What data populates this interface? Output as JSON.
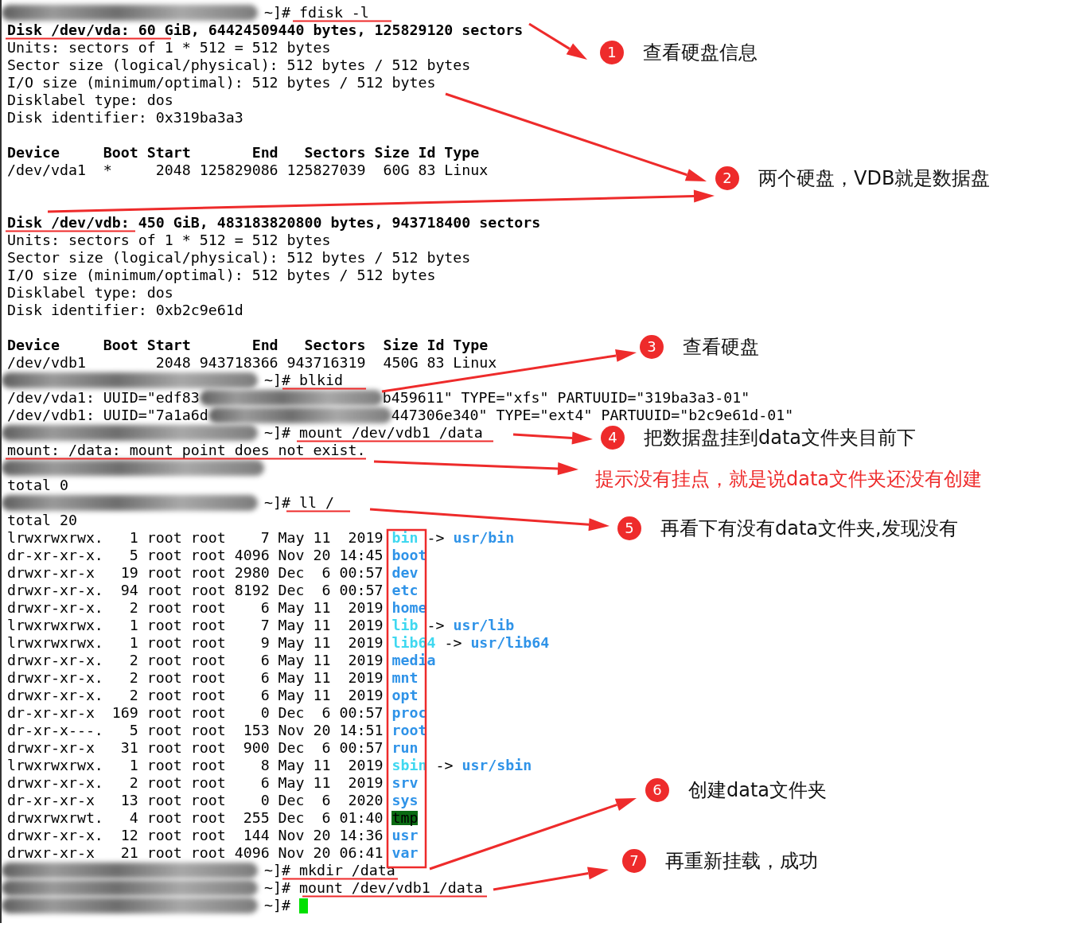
{
  "terminal": {
    "lines": [
      {
        "kind": "prompt",
        "text": "~]# fdisk -l"
      },
      {
        "kind": "heading",
        "text": "Disk /dev/vda: 60 GiB, 64424509440 bytes, 125829120 sectors"
      },
      {
        "kind": "plain",
        "text": "Units: sectors of 1 * 512 = 512 bytes"
      },
      {
        "kind": "plain",
        "text": "Sector size (logical/physical): 512 bytes / 512 bytes"
      },
      {
        "kind": "plain",
        "text": "I/O size (minimum/optimal): 512 bytes / 512 bytes"
      },
      {
        "kind": "plain",
        "text": "Disklabel type: dos"
      },
      {
        "kind": "plain",
        "text": "Disk identifier: 0x319ba3a3"
      },
      {
        "kind": "blank"
      },
      {
        "kind": "heading",
        "text": "Device     Boot Start       End   Sectors Size Id Type"
      },
      {
        "kind": "plain",
        "text": "/dev/vda1  *     2048 125829086 125827039  60G 83 Linux"
      },
      {
        "kind": "blank"
      },
      {
        "kind": "blank"
      },
      {
        "kind": "heading",
        "text": "Disk /dev/vdb: 450 GiB, 483183820800 bytes, 943718400 sectors"
      },
      {
        "kind": "plain",
        "text": "Units: sectors of 1 * 512 = 512 bytes"
      },
      {
        "kind": "plain",
        "text": "Sector size (logical/physical): 512 bytes / 512 bytes"
      },
      {
        "kind": "plain",
        "text": "I/O size (minimum/optimal): 512 bytes / 512 bytes"
      },
      {
        "kind": "plain",
        "text": "Disklabel type: dos"
      },
      {
        "kind": "plain",
        "text": "Disk identifier: 0xb2c9e61d"
      },
      {
        "kind": "blank"
      },
      {
        "kind": "heading",
        "text": "Device     Boot Start       End   Sectors  Size Id Type"
      },
      {
        "kind": "plain",
        "text": "/dev/vdb1        2048 943718366 943716319  450G 83 Linux"
      },
      {
        "kind": "prompt",
        "text": "~]# blkid"
      },
      {
        "kind": "split",
        "before": "/dev/vda1: UUID=\"edf83",
        "after": "b459611\" TYPE=\"xfs\" PARTUUID=\"319ba3a3-01\""
      },
      {
        "kind": "split",
        "before": "/dev/vdb1: UUID=\"7a1a6d",
        "after": "447306e340\" TYPE=\"ext4\" PARTUUID=\"b2c9e61d-01\""
      },
      {
        "kind": "prompt",
        "text": "~]# mount /dev/vdb1 /data"
      },
      {
        "kind": "plain",
        "text": "mount: /data: mount point does not exist."
      },
      {
        "kind": "redacted"
      },
      {
        "kind": "plain",
        "text": "total 0"
      },
      {
        "kind": "prompt",
        "text": "~]# ll /"
      },
      {
        "kind": "plain",
        "text": "total 20"
      },
      {
        "kind": "ls",
        "text": "lrwxrwxrwx.   1 root root    7 May 11  2019 ",
        "file": {
          "kind": "link",
          "name": "bin",
          "arrow": "->",
          "target": "usr/bin"
        }
      },
      {
        "kind": "ls",
        "text": "dr-xr-xr-x.   5 root root 4096 Nov 20 14:45 ",
        "file": {
          "kind": "dir",
          "name": "boot"
        }
      },
      {
        "kind": "ls",
        "text": "drwxr-xr-x   19 root root 2980 Dec  6 00:57 ",
        "file": {
          "kind": "dir",
          "name": "dev"
        }
      },
      {
        "kind": "ls",
        "text": "drwxr-xr-x.  94 root root 8192 Dec  6 00:57 ",
        "file": {
          "kind": "dir",
          "name": "etc"
        }
      },
      {
        "kind": "ls",
        "text": "drwxr-xr-x.   2 root root    6 May 11  2019 ",
        "file": {
          "kind": "dir",
          "name": "home"
        }
      },
      {
        "kind": "ls",
        "text": "lrwxrwxrwx.   1 root root    7 May 11  2019 ",
        "file": {
          "kind": "link",
          "name": "lib",
          "arrow": "->",
          "target": "usr/lib"
        }
      },
      {
        "kind": "ls",
        "text": "lrwxrwxrwx.   1 root root    9 May 11  2019 ",
        "file": {
          "kind": "link",
          "name": "lib64",
          "arrow": "->",
          "target": "usr/lib64"
        }
      },
      {
        "kind": "ls",
        "text": "drwxr-xr-x.   2 root root    6 May 11  2019 ",
        "file": {
          "kind": "dir",
          "name": "media"
        }
      },
      {
        "kind": "ls",
        "text": "drwxr-xr-x.   2 root root    6 May 11  2019 ",
        "file": {
          "kind": "dir",
          "name": "mnt"
        }
      },
      {
        "kind": "ls",
        "text": "drwxr-xr-x.   2 root root    6 May 11  2019 ",
        "file": {
          "kind": "dir",
          "name": "opt"
        }
      },
      {
        "kind": "ls",
        "text": "dr-xr-xr-x  169 root root    0 Dec  6 00:57 ",
        "file": {
          "kind": "dir",
          "name": "proc"
        }
      },
      {
        "kind": "ls",
        "text": "dr-xr-x---.   5 root root  153 Nov 20 14:51 ",
        "file": {
          "kind": "dir",
          "name": "root"
        }
      },
      {
        "kind": "ls",
        "text": "drwxr-xr-x   31 root root  900 Dec  6 00:57 ",
        "file": {
          "kind": "dir",
          "name": "run"
        }
      },
      {
        "kind": "ls",
        "text": "lrwxrwxrwx.   1 root root    8 May 11  2019 ",
        "file": {
          "kind": "link",
          "name": "sbin",
          "arrow": "->",
          "target": "usr/sbin"
        }
      },
      {
        "kind": "ls",
        "text": "drwxr-xr-x.   2 root root    6 May 11  2019 ",
        "file": {
          "kind": "dir",
          "name": "srv"
        }
      },
      {
        "kind": "ls",
        "text": "dr-xr-xr-x   13 root root    0 Dec  6  2020 ",
        "file": {
          "kind": "dir",
          "name": "sys"
        }
      },
      {
        "kind": "ls",
        "text": "drwxrwxrwt.   4 root root  255 Dec  6 01:40 ",
        "file": {
          "kind": "sticky",
          "name": "tmp"
        }
      },
      {
        "kind": "ls",
        "text": "drwxr-xr-x.  12 root root  144 Nov 20 14:36 ",
        "file": {
          "kind": "dir",
          "name": "usr"
        }
      },
      {
        "kind": "ls",
        "text": "drwxr-xr-x   21 root root 4096 Nov 20 06:41 ",
        "file": {
          "kind": "dir",
          "name": "var"
        }
      },
      {
        "kind": "prompt",
        "text": "~]# mkdir /data"
      },
      {
        "kind": "prompt",
        "text": "~]# mount /dev/vdb1 /data"
      },
      {
        "kind": "prompt",
        "text": "~]#",
        "cursor": true
      }
    ]
  },
  "annotations": [
    {
      "kind": "step",
      "number": "1",
      "text": "查看硬盘信息"
    },
    {
      "kind": "step",
      "number": "2",
      "text": "两个硬盘，VDB就是数据盘"
    },
    {
      "kind": "step",
      "number": "3",
      "text": "查看硬盘"
    },
    {
      "kind": "step",
      "number": "4",
      "text": "把数据盘挂到data文件夹目前下"
    },
    {
      "kind": "warning",
      "text": "提示没有挂点，就是说data文件夹还没有创建"
    },
    {
      "kind": "step",
      "number": "5",
      "text": "再看下有没有data文件夹,发现没有"
    },
    {
      "kind": "step",
      "number": "6",
      "text": "创建data文件夹"
    },
    {
      "kind": "step",
      "number": "7",
      "text": "再重新挂载，成功"
    }
  ]
}
